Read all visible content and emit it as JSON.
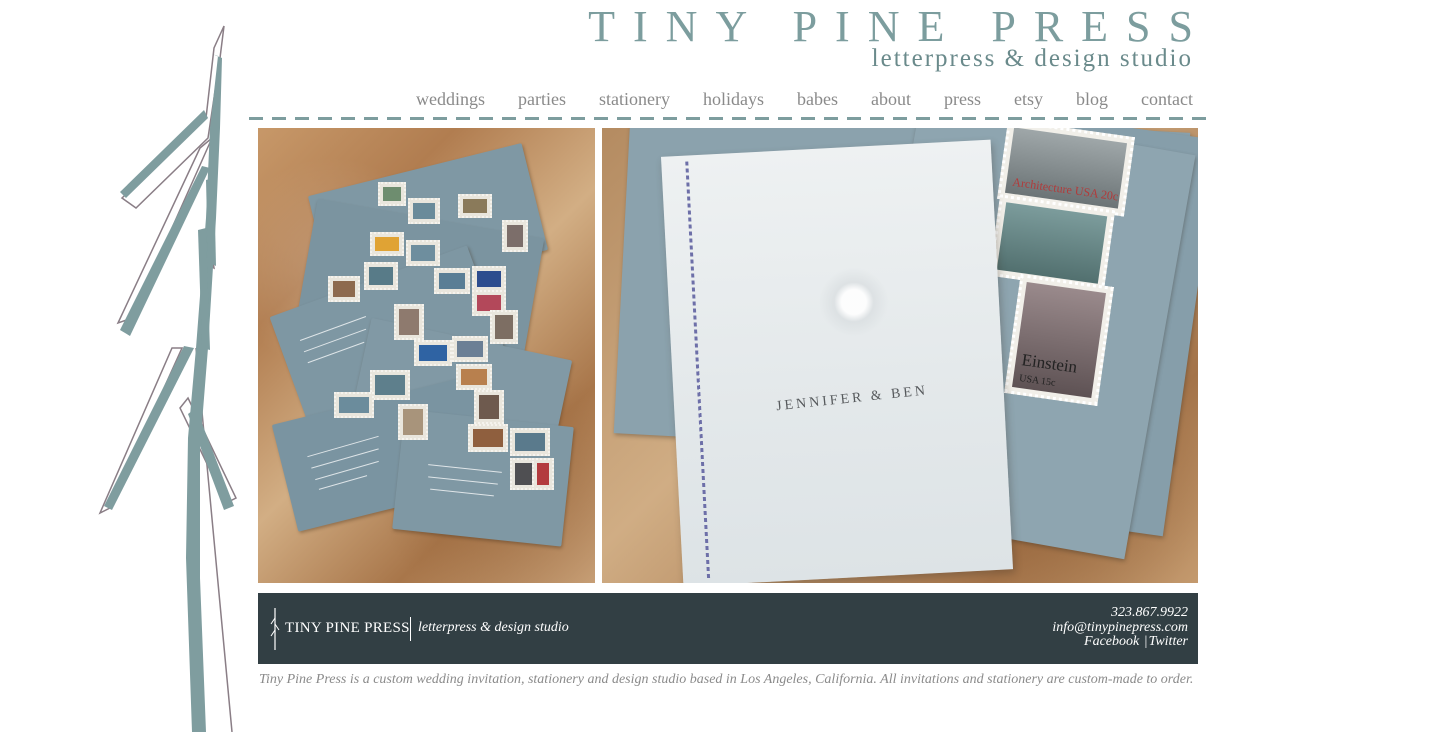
{
  "brand": {
    "title": "TINY PINE PRESS",
    "subtitle": "letterpress & design studio",
    "accent_color": "#7c9d9e",
    "footer_color": "#323f44"
  },
  "nav": {
    "items": [
      {
        "label": "weddings"
      },
      {
        "label": "parties"
      },
      {
        "label": "stationery"
      },
      {
        "label": "holidays"
      },
      {
        "label": "babes"
      },
      {
        "label": "about"
      },
      {
        "label": "press"
      },
      {
        "label": "etsy"
      },
      {
        "label": "blog"
      },
      {
        "label": "contact"
      }
    ]
  },
  "gallery": {
    "right_photo": {
      "booklet_names": "JENNIFER & BEN",
      "stamp_top_caption": "Architecture USA 20c",
      "stamp_bottom_caption": "Einstein",
      "stamp_bottom_value": "USA 15c"
    }
  },
  "footer": {
    "name": "TINY PINE PRESS",
    "tagline": "letterpress & design studio",
    "phone": "323.867.9922",
    "email": "info@tinypinepress.com",
    "facebook": "Facebook",
    "separator": "|",
    "twitter": "Twitter"
  },
  "about_text": "Tiny Pine Press is a custom wedding invitation, stationery and design studio based in Los Angeles, California. All invitations and stationery are custom-made to order."
}
